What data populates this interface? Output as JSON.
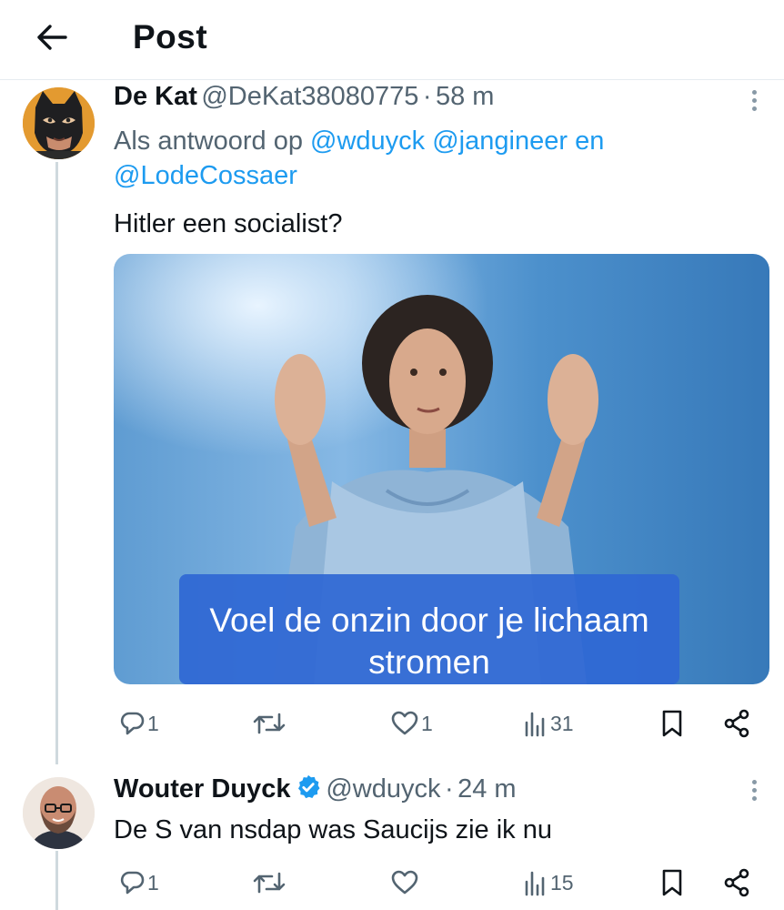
{
  "header": {
    "title": "Post"
  },
  "tweets": [
    {
      "name": "De Kat",
      "handle": "@DeKat38080775",
      "dot": "·",
      "time": "58 m",
      "reply_prefix": "Als antwoord op",
      "reply_mentions": [
        "@wduyck",
        "@jangineer",
        "@LodeCossaer"
      ],
      "reply_joiner": "en",
      "text": "Hitler een socialist?",
      "media": {
        "caption_line1": "Voel de onzin door je lichaam",
        "caption_line2": "stromen"
      },
      "stats": {
        "replies": "1",
        "likes": "1",
        "views": "31"
      }
    },
    {
      "name": "Wouter Duyck",
      "verified": true,
      "handle": "@wduyck",
      "dot": "·",
      "time": "24 m",
      "text": "De S van nsdap was Saucijs zie ik nu",
      "stats": {
        "replies": "1",
        "likes": "",
        "views": "15"
      }
    }
  ],
  "icons": {
    "back": "arrow-left-icon",
    "more": "more-vertical-icon",
    "reply": "reply-icon",
    "retweet": "retweet-icon",
    "like": "heart-icon",
    "views": "analytics-icon",
    "bookmark": "bookmark-icon",
    "share": "share-icon",
    "verified": "verified-badge-icon"
  },
  "colors": {
    "accent": "#1d9bf0",
    "muted": "#536471",
    "text": "#0f1419",
    "thread_line": "#cfd9de"
  }
}
